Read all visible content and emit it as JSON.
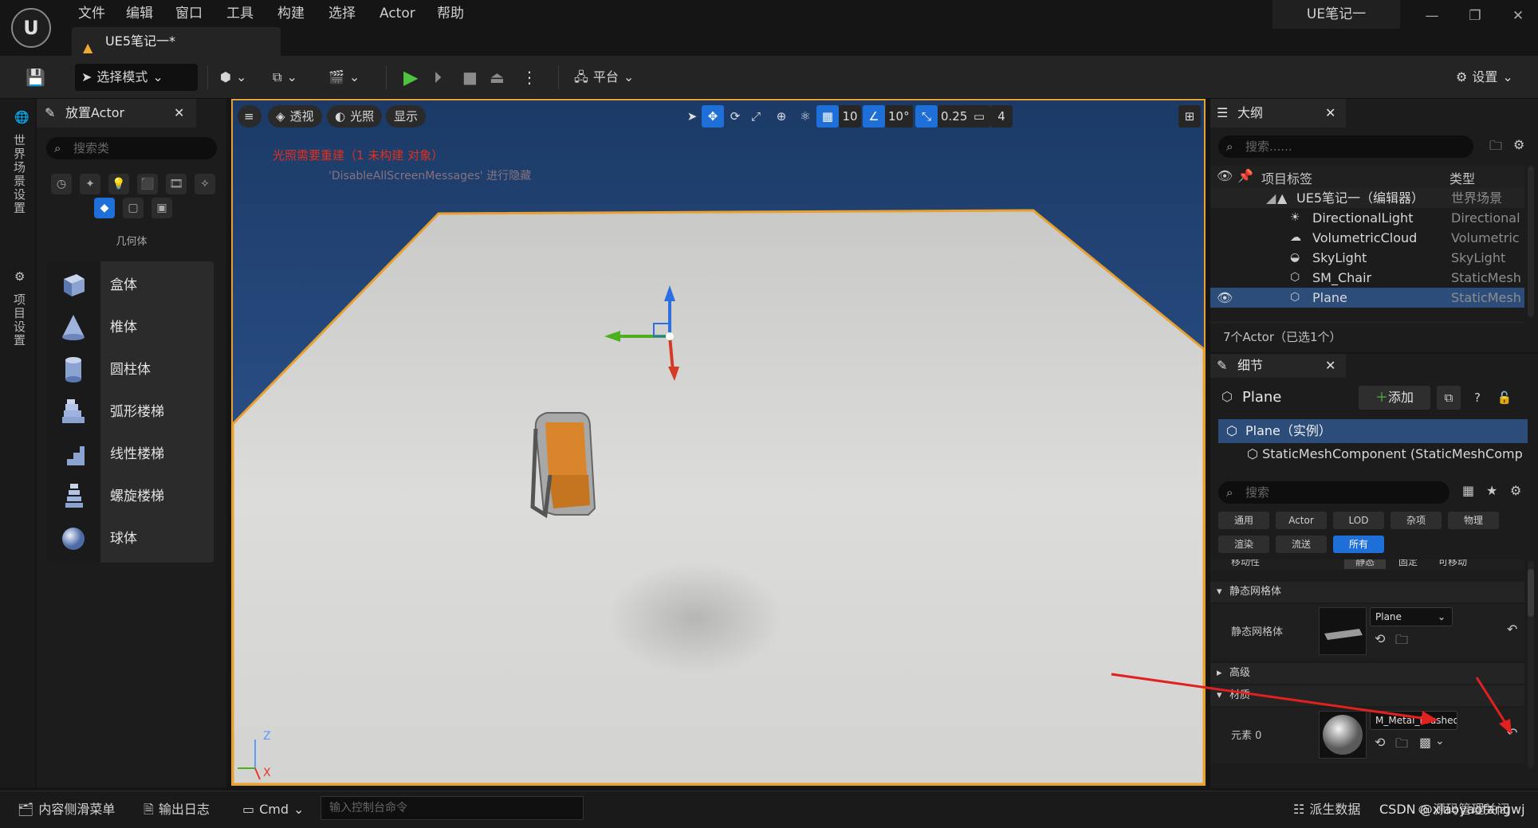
{
  "menu": [
    "文件",
    "编辑",
    "窗口",
    "工具",
    "构建",
    "选择",
    "Actor",
    "帮助"
  ],
  "doc_tab": "UE5笔记一*",
  "project_name": "UE笔记一",
  "toolbar": {
    "select_mode": "选择模式",
    "platform": "平台",
    "settings": "设置"
  },
  "left_strip": {
    "world_settings": "世界场景设置",
    "project_settings": "项目设置"
  },
  "place_actor": {
    "tab": "放置Actor",
    "search_placeholder": "搜索类",
    "category_label": "几何体",
    "items": [
      {
        "label": "盒体",
        "icon": "box-icon"
      },
      {
        "label": "椎体",
        "icon": "cone-icon"
      },
      {
        "label": "圆柱体",
        "icon": "cylinder-icon"
      },
      {
        "label": "弧形楼梯",
        "icon": "curved-stairs-icon"
      },
      {
        "label": "线性楼梯",
        "icon": "linear-stairs-icon"
      },
      {
        "label": "螺旋楼梯",
        "icon": "spiral-stairs-icon"
      },
      {
        "label": "球体",
        "icon": "sphere-icon"
      }
    ]
  },
  "viewport": {
    "perspective": "透视",
    "lighting": "光照",
    "show": "显示",
    "grid_snap": "10",
    "rotation_snap": "10°",
    "scale_snap": "0.25",
    "camera_speed": "4",
    "lighting_warning": "光照需要重建（1 未构建 对象）",
    "lighting_sub": "'DisableAllScreenMessages' 进行隐藏",
    "axis_z": "Z",
    "axis_x": "X",
    "colors": {
      "selection": "#e8a030",
      "warning": "#e03020"
    }
  },
  "outliner": {
    "tab": "大纲",
    "search_placeholder": "搜索......",
    "col_label": "项目标签",
    "col_type": "类型",
    "root": {
      "name": "UE5笔记一（编辑器）",
      "type": "世界场景"
    },
    "rows": [
      {
        "name": "DirectionalLight",
        "type": "Directional",
        "icon": "sun-icon",
        "selected": false
      },
      {
        "name": "VolumetricCloud",
        "type": "Volumetric",
        "icon": "cloud-icon",
        "selected": false
      },
      {
        "name": "SkyLight",
        "type": "SkyLight",
        "icon": "skylight-icon",
        "selected": false
      },
      {
        "name": "SM_Chair",
        "type": "StaticMesh",
        "icon": "mesh-icon",
        "selected": false
      },
      {
        "name": "Plane",
        "type": "StaticMesh",
        "icon": "mesh-icon",
        "selected": true
      }
    ],
    "count": "7个Actor（已选1个）"
  },
  "details": {
    "tab": "细节",
    "title": "Plane",
    "add_label": "添加",
    "instance_label": "Plane（实例）",
    "component_label": "StaticMeshComponent (StaticMeshComp",
    "search_placeholder": "搜索",
    "filters_row1": [
      "通用",
      "Actor",
      "LOD",
      "杂项",
      "物理"
    ],
    "filters_row2": [
      "渲染",
      "流送",
      "所有"
    ],
    "mobility_label": "移动性",
    "mobility_options": [
      "静态",
      "固定",
      "可移动"
    ],
    "section_static_mesh": "静态网格体",
    "prop_static_mesh": "静态网格体",
    "static_mesh_value": "Plane",
    "section_advanced": "高级",
    "section_material": "材质",
    "prop_element0": "元素 0",
    "material_value": "M_Metal_Brushed"
  },
  "statusbar": {
    "content_drawer": "内容侧滑菜单",
    "output_log": "输出日志",
    "cmd": "Cmd",
    "console_placeholder": "输入控制台命令",
    "derived_data": "派生数据",
    "source_control": "源码管理关闭"
  },
  "watermark": "CSDN @xiaoyaofangwj"
}
